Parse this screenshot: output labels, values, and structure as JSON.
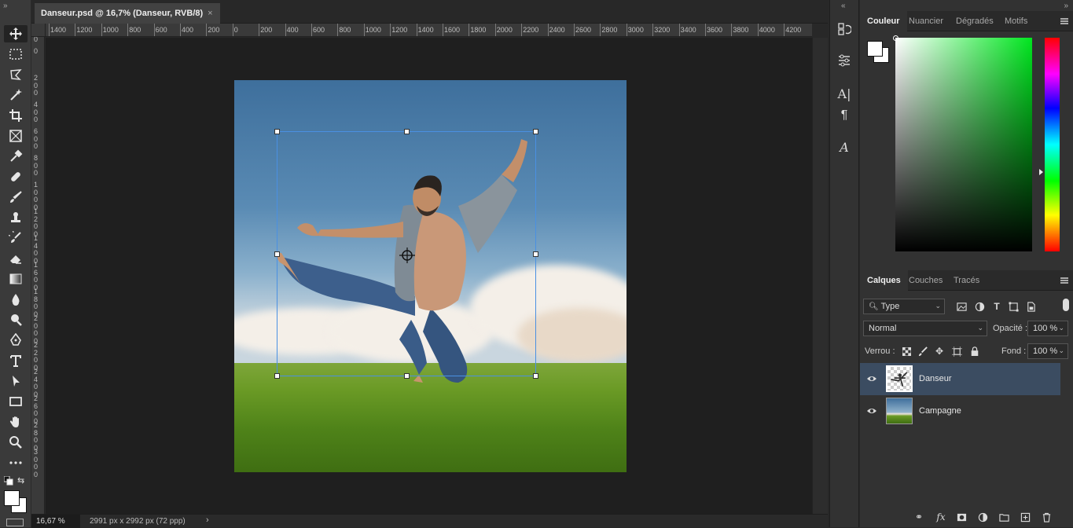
{
  "document": {
    "tab_title": "Danseur.psd @ 16,7% (Danseur, RVB/8)",
    "close_symbol": "×"
  },
  "ruler_top_labels": [
    "1400",
    "1200",
    "1000",
    "800",
    "600",
    "400",
    "200",
    "0",
    "200",
    "400",
    "600",
    "800",
    "1000",
    "1200",
    "1400",
    "1600",
    "1800",
    "2000",
    "2200",
    "2400",
    "2600",
    "2800",
    "3000",
    "3200",
    "3400",
    "3600",
    "3800",
    "4000",
    "4200"
  ],
  "ruler_left_labels": [
    "200",
    "0",
    "200",
    "400",
    "600",
    "800",
    "1000",
    "1200",
    "1400",
    "1600",
    "1800",
    "2000",
    "2200",
    "2400",
    "2600",
    "2800",
    "3000"
  ],
  "tools": [
    "move-icon",
    "marquee-icon",
    "lasso-icon",
    "magic-wand-icon",
    "crop-icon",
    "frame-icon",
    "eyedropper-icon",
    "healing-brush-icon",
    "brush-icon",
    "stamp-icon",
    "history-brush-icon",
    "eraser-icon",
    "gradient-icon",
    "blur-icon",
    "dodge-icon",
    "pen-icon",
    "type-icon",
    "path-selection-icon",
    "rectangle-icon",
    "hand-icon",
    "zoom-icon",
    "more-tools-icon"
  ],
  "color_panel": {
    "tabs": [
      "Couleur",
      "Nuancier",
      "Dégradés",
      "Motifs"
    ],
    "active_tab": "Couleur",
    "foreground": "#ffffff",
    "background": "#ffffff"
  },
  "layers_panel": {
    "tabs": [
      "Calques",
      "Couches",
      "Tracés"
    ],
    "active_tab": "Calques",
    "filter_label": "Type",
    "blend_mode": "Normal",
    "opacity_label": "Opacité :",
    "opacity_value": "100 %",
    "lock_label": "Verrou :",
    "fill_label": "Fond :",
    "fill_value": "100 %",
    "layers": [
      {
        "name": "Danseur",
        "selected": true
      },
      {
        "name": "Campagne",
        "selected": false
      }
    ]
  },
  "status": {
    "zoom": "16,67 %",
    "doc_info": "2991 px x 2992 px (72 ppp)",
    "arrow": "›"
  },
  "colors": {
    "accent_selection": "#3b4c61",
    "transform_box": "#4a90e2"
  }
}
